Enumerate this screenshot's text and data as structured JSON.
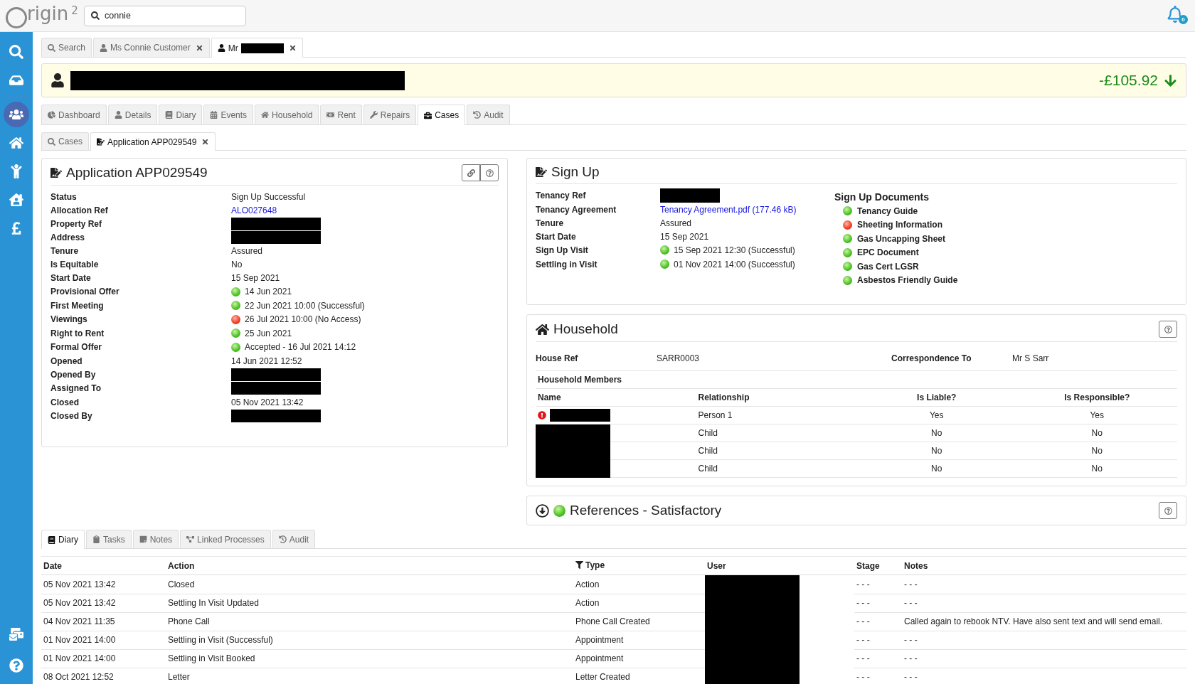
{
  "header": {
    "logo": {
      "text": "rigin",
      "sup": "2"
    },
    "search": {
      "value": "connie"
    },
    "notifications": {
      "count": "0"
    }
  },
  "sidebar": {
    "top": [
      {
        "kind": "search",
        "selected": false
      },
      {
        "kind": "inbox",
        "selected": false
      },
      {
        "kind": "people",
        "selected": true
      },
      {
        "kind": "home",
        "selected": false
      },
      {
        "kind": "lift",
        "selected": false
      },
      {
        "kind": "house-person",
        "selected": false
      },
      {
        "kind": "pound",
        "selected": false
      }
    ],
    "bottom": [
      {
        "kind": "mail",
        "selected": false
      },
      {
        "kind": "help",
        "selected": false
      }
    ]
  },
  "record_tabs": [
    {
      "label": "Search",
      "kind": "search",
      "closable": false,
      "redacted": false,
      "selected": false
    },
    {
      "label": "Ms Connie Customer",
      "kind": "person",
      "closable": true,
      "redacted": false,
      "selected": false
    },
    {
      "label": "Mr",
      "kind": "person",
      "closable": true,
      "redacted": true,
      "selected": true
    }
  ],
  "banner": {
    "name_redacted": true,
    "balance": "-£105.92",
    "falling": true
  },
  "section_tabs": [
    {
      "label": "Dashboard",
      "kind": "dashboard",
      "selected": false
    },
    {
      "label": "Details",
      "kind": "person",
      "selected": false
    },
    {
      "label": "Diary",
      "kind": "diary",
      "selected": false
    },
    {
      "label": "Events",
      "kind": "events",
      "selected": false
    },
    {
      "label": "Household",
      "kind": "home",
      "selected": false
    },
    {
      "label": "Rent",
      "kind": "rent",
      "selected": false
    },
    {
      "label": "Repairs",
      "kind": "repairs",
      "selected": false
    },
    {
      "label": "Cases",
      "kind": "cases",
      "selected": true
    },
    {
      "label": "Audit",
      "kind": "audit",
      "selected": false
    }
  ],
  "case_tabs": [
    {
      "label": "Cases",
      "kind": "search",
      "closable": false,
      "selected": false
    },
    {
      "label": "Application APP029549",
      "kind": "document",
      "closable": true,
      "selected": true
    }
  ],
  "application": {
    "title": "Application APP029549",
    "fields": [
      {
        "label": "Status",
        "value": "Sign Up Successful"
      },
      {
        "label": "Allocation Ref",
        "value": "ALO027648",
        "kind": "link"
      },
      {
        "label": "Property Ref",
        "kind": "redacted"
      },
      {
        "label": "Address",
        "kind": "redacted"
      },
      {
        "label": "Tenure",
        "value": "Assured"
      },
      {
        "label": "Is Equitable",
        "value": "No"
      },
      {
        "label": "Start Date",
        "value": "15 Sep 2021"
      },
      {
        "label": "Provisional Offer",
        "value": "14 Jun 2021",
        "success": true
      },
      {
        "label": "First Meeting",
        "value": "22 Jun 2021 10:00 (Successful)",
        "success": true
      },
      {
        "label": "Viewings",
        "value": "26 Jul 2021 10:00 (No Access)",
        "success": false
      },
      {
        "label": "Right to Rent",
        "value": "25 Jun 2021",
        "success": true
      },
      {
        "label": "Formal Offer",
        "value": "Accepted - 16 Jul 2021 14:12",
        "success": true
      },
      {
        "label": "Opened",
        "value": "14 Jun 2021 12:52"
      },
      {
        "label": "Opened By",
        "kind": "redacted"
      },
      {
        "label": "Assigned To",
        "kind": "redacted"
      },
      {
        "label": "Closed",
        "value": "05 Nov 2021 13:42"
      },
      {
        "label": "Closed By",
        "kind": "redacted"
      }
    ]
  },
  "sign_up": {
    "title": "Sign Up",
    "fields": [
      {
        "label": "Tenancy Ref",
        "kind": "redacted"
      },
      {
        "label": "Tenancy Agreement",
        "value": "Tenancy Agreement.pdf (177.46 kB)",
        "kind": "link"
      },
      {
        "label": "Tenure",
        "value": "Assured"
      },
      {
        "label": "Start Date",
        "value": "15 Sep 2021"
      },
      {
        "label": "Sign Up Visit",
        "value": "15 Sep 2021 12:30 (Successful)",
        "success": true
      },
      {
        "label": "Settling in Visit",
        "value": "01 Nov 2021 14:00 (Successful)",
        "success": true
      }
    ],
    "documents": {
      "title": "Sign Up Documents",
      "items": [
        {
          "label": "Tenancy Guide",
          "success": true
        },
        {
          "label": "Sheeting Information",
          "success": false
        },
        {
          "label": "Gas Uncapping Sheet",
          "success": true
        },
        {
          "label": "EPC Document",
          "success": true
        },
        {
          "label": "Gas Cert LGSR",
          "success": true
        },
        {
          "label": "Asbestos Friendly Guide",
          "success": true
        }
      ]
    }
  },
  "household": {
    "title": "Household",
    "house_ref": {
      "label": "House Ref",
      "value": "SARR0003"
    },
    "correspondence": {
      "label": "Correspondence To",
      "value": "Mr S Sarr"
    },
    "members_title": "Household Members",
    "columns": [
      "Name",
      "Relationship",
      "Is Liable?",
      "Is Responsible?"
    ],
    "rows": [
      {
        "warning": true,
        "relationship": "Person 1",
        "liable": "Yes",
        "responsible": "Yes"
      },
      {
        "warning": false,
        "relationship": "Child",
        "liable": "No",
        "responsible": "No"
      },
      {
        "warning": false,
        "relationship": "Child",
        "liable": "No",
        "responsible": "No"
      },
      {
        "warning": false,
        "relationship": "Child",
        "liable": "No",
        "responsible": "No"
      }
    ]
  },
  "references": {
    "title": "References - Satisfactory",
    "success": true
  },
  "diary_tabs": [
    {
      "label": "Diary",
      "kind": "diary",
      "selected": true
    },
    {
      "label": "Tasks",
      "kind": "tasks",
      "selected": false
    },
    {
      "label": "Notes",
      "kind": "notes",
      "selected": false
    },
    {
      "label": "Linked Processes",
      "kind": "linked",
      "selected": false
    },
    {
      "label": "Audit",
      "kind": "audit",
      "selected": false
    }
  ],
  "diary": {
    "columns": [
      "Date",
      "Action",
      "Type",
      "User",
      "Stage",
      "Notes"
    ],
    "rows": [
      [
        "05 Nov 2021 13:42",
        "Closed",
        "Action",
        "",
        "- - -",
        "- - -"
      ],
      [
        "05 Nov 2021 13:42",
        "Settling In Visit Updated",
        "Action",
        "",
        "- - -",
        "- - -"
      ],
      [
        "04 Nov 2021 11:35",
        "Phone Call",
        "Phone Call Created",
        "",
        "- - -",
        "Called again to rebook NTV. Have also sent text and will send email."
      ],
      [
        "01 Nov 2021 14:00",
        "Settling in Visit (Successful)",
        "Appointment",
        "",
        "- - -",
        "- - -"
      ],
      [
        "01 Nov 2021 14:00",
        "Settling in Visit Booked",
        "Appointment",
        "",
        "- - -",
        "- - -"
      ],
      [
        "08 Oct 2021 12:52",
        "Letter",
        "Letter Created",
        "",
        "- - -",
        "- - -"
      ]
    ]
  }
}
